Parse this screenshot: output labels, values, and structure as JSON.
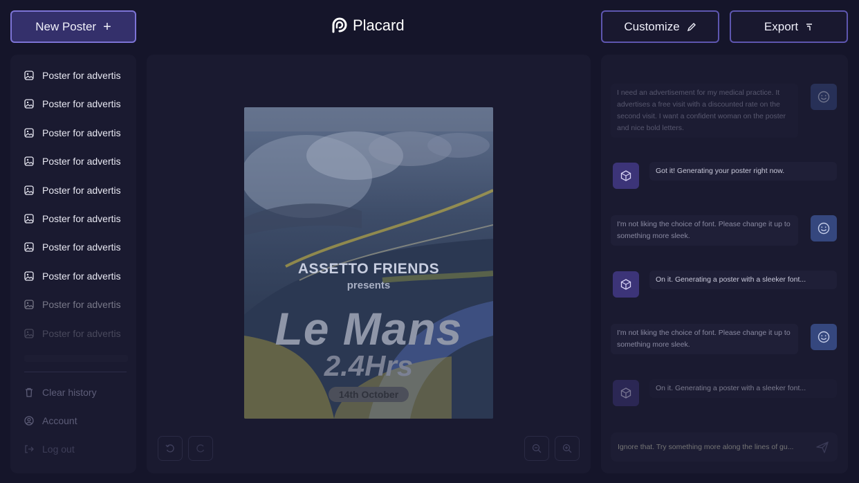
{
  "header": {
    "new_poster_label": "New Poster",
    "brand": "Placard",
    "customize_label": "Customize",
    "export_label": "Export"
  },
  "sidebar": {
    "history": [
      {
        "label": "Poster for advertis",
        "opacity": 1
      },
      {
        "label": "Poster for advertis",
        "opacity": 1
      },
      {
        "label": "Poster for advertis",
        "opacity": 1
      },
      {
        "label": "Poster for advertis",
        "opacity": 1
      },
      {
        "label": "Poster for advertis",
        "opacity": 1
      },
      {
        "label": "Poster for advertis",
        "opacity": 1
      },
      {
        "label": "Poster for advertis",
        "opacity": 1
      },
      {
        "label": "Poster for advertis",
        "opacity": 1
      },
      {
        "label": "Poster for advertis",
        "opacity": 0.45
      },
      {
        "label": "Poster for advertis",
        "opacity": 0.22
      }
    ],
    "clear_history": "Clear history",
    "account": "Account",
    "logout": "Log out"
  },
  "poster": {
    "line1": "ASSETTO FRIENDS",
    "line2": "presents",
    "line3": "Le Mans",
    "line4": "2.4Hrs",
    "date": "14th October"
  },
  "chat": {
    "messages": [
      {
        "role": "user",
        "text": "I need an advertisement for my medical practice. It advertises a free visit with a discounted rate on the second visit. I want a confident woman on the poster and nice bold letters.",
        "dim": true
      },
      {
        "role": "bot",
        "text": "Got it! Generating your poster right now.",
        "dim": false
      },
      {
        "role": "user",
        "text": "I'm not liking the choice of font. Please change it up to something more sleek.",
        "dim": false
      },
      {
        "role": "bot",
        "text": "On it. Generating a poster with a sleeker font...",
        "dim": false
      },
      {
        "role": "user",
        "text": "I'm not liking the choice of font. Please change it up to something more sleek.",
        "dim": false
      },
      {
        "role": "bot",
        "text": "On it. Generating a poster with a sleeker font...",
        "dim": true
      }
    ],
    "input_placeholder": "Ignore that. Try something more along the lines of gu..."
  },
  "colors": {
    "background": "#15152a",
    "panel": "#1a1a30",
    "accent": "#7d74d6",
    "user_avatar": "#35477e",
    "bot_avatar": "#3c3478"
  }
}
